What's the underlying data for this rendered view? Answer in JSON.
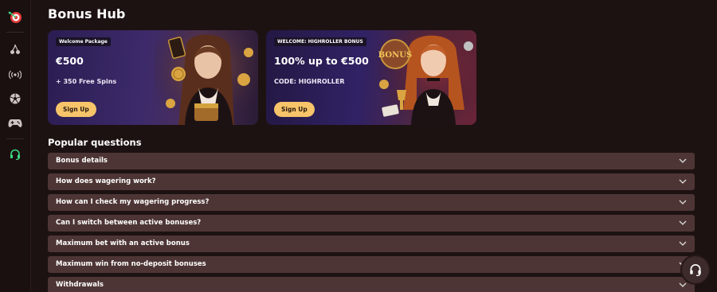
{
  "page": {
    "title": "Bonus Hub"
  },
  "sidebar": {
    "icons": [
      "target-logo-icon",
      "cherries-icon",
      "broadcast-icon",
      "soccer-ball-icon",
      "gamepad-icon",
      "headset-icon"
    ]
  },
  "promos": [
    {
      "tag": "Welcome Package",
      "headline": "€500",
      "subline": "+ 350 Free Spins",
      "button": "Sign Up"
    },
    {
      "tag": "WELCOME: HIGHROLLER BONUS",
      "headline": "100% up to €500",
      "subline": "CODE: HIGHROLLER",
      "button": "Sign Up"
    }
  ],
  "faq": {
    "title": "Popular questions",
    "items": [
      "Bonus details",
      "How does wagering work?",
      "How can I check my wagering progress?",
      "Can I switch between active bonuses?",
      "Maximum bet with an active bonus",
      "Maximum win from no-deposit bonuses",
      "Withdrawals"
    ]
  },
  "colors": {
    "accent_button": "#f7c46a",
    "faq_bg": "#4e3535",
    "page_bg": "#1d1212",
    "support_icon": "#3ddc84"
  }
}
